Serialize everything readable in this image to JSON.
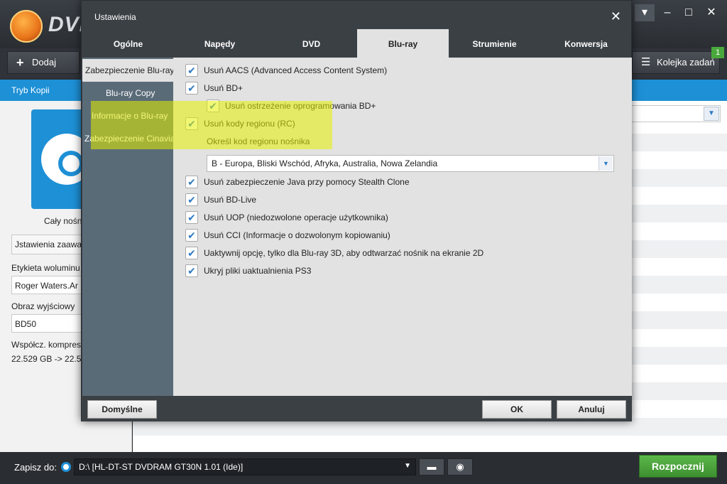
{
  "app": {
    "logo_text": "DVI",
    "toolbar": {
      "add_label": "Dodaj",
      "queue_label": "Kolejka zadań",
      "queue_badge": "1"
    },
    "mode_label": "Tryb Kopii",
    "left": {
      "disc_caption": "Cały nośn",
      "advanced_settings": "Jstawienia zaawa",
      "volume_label_caption": "Etykieta woluminu",
      "volume_label_value": "Roger Waters.Ar",
      "output_image_caption": "Obraz wyjściowy",
      "output_image_value": "BD50",
      "compression_caption": "Współcz. kompres",
      "compression_value": "22.529 GB -> 22.5"
    },
    "bottom": {
      "save_to_label": "Zapisz do:",
      "drive_value": "D:\\ [HL-DT-ST DVDRAM GT30N 1.01 (Ide)]",
      "start_label": "Rozpocznij"
    }
  },
  "dialog": {
    "title": "Ustawienia",
    "tabs": [
      "Ogólne",
      "Napędy",
      "DVD",
      "Blu-ray",
      "Strumienie",
      "Konwersja"
    ],
    "active_tab": "Blu-ray",
    "side_items": [
      "Zabezpieczenie Blu-ray",
      "Blu-ray Copy",
      "Informacje o Blu-ray",
      "Zabezpieczenie Cinavia"
    ],
    "options": {
      "aacs": "Usuń AACS (Advanced Access Content System)",
      "bdplus": "Usuń BD+",
      "bdplus_warning": "Usuń ostrzeżenie oprogramowania BD+",
      "region_codes": "Usuń kody regionu (RC)",
      "region_caption": "Określ kod regionu nośnika",
      "region_value": "B - Europa, Bliski Wschód, Afryka, Australia, Nowa Zelandia",
      "java": "Usuń zabezpieczenie Java przy pomocy Stealth Clone",
      "bdlive": "Usuń BD-Live",
      "uop": "Usuń UOP (niedozwolone operacje użytkownika)",
      "cci": "Usuń CCI (Informacje o dozwolonym kopiowaniu)",
      "only3d": "Uaktywnij opcję, tylko dla Blu-ray 3D, aby odtwarzać nośnik na ekranie 2D",
      "ps3": "Ukryj pliki uaktualnienia PS3"
    },
    "buttons": {
      "defaults": "Domyślne",
      "ok": "OK",
      "cancel": "Anuluj"
    }
  },
  "colors": {
    "accent": "#1e90d6",
    "start": "#4aa63a",
    "highlight": "#e6f000"
  }
}
